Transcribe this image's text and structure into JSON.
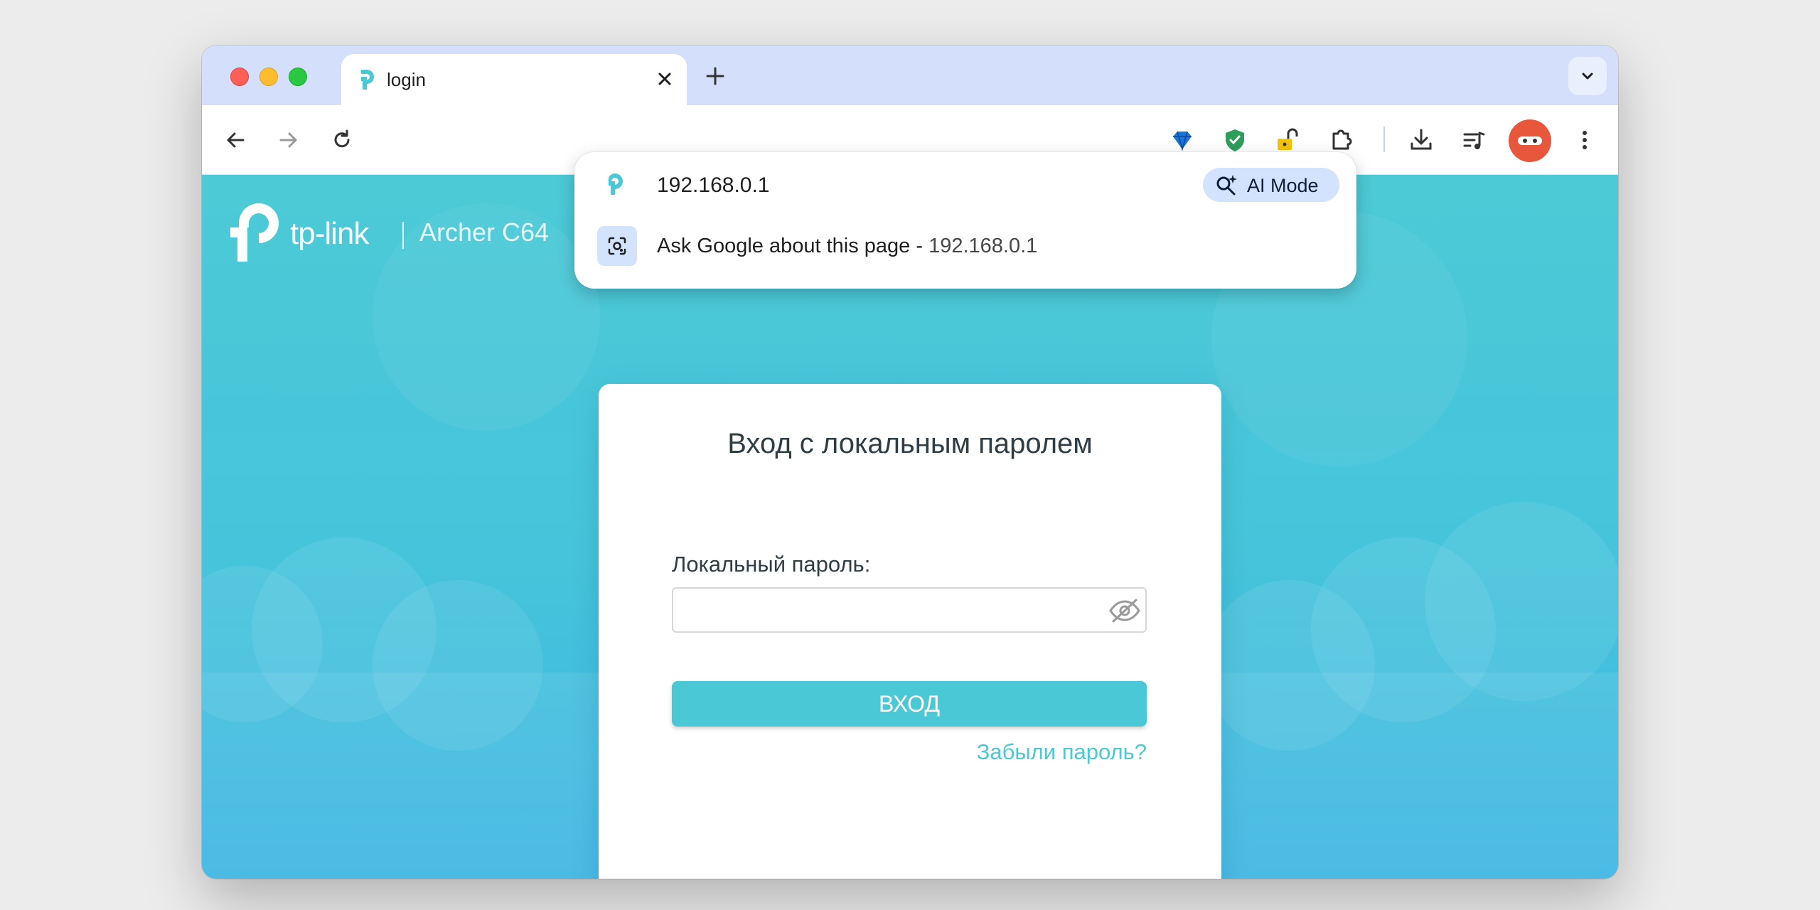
{
  "browser": {
    "tab": {
      "title": "login"
    },
    "omnibox": {
      "url": "192.168.0.1",
      "ai_mode_label": "AI Mode",
      "suggestion_prefix": "Ask Google about this page -",
      "suggestion_url": "192.168.0.1"
    },
    "icons": {
      "back": "back-arrow-icon",
      "forward": "forward-arrow-icon",
      "reload": "reload-icon",
      "extensions": [
        "diamond-extension-icon",
        "shield-extension-icon",
        "lock-extension-icon",
        "puzzle-icon"
      ],
      "download": "download-icon",
      "reading_list": "reading-list-icon",
      "menu": "kebab-menu-icon"
    },
    "accent_color": "#d4e0fb"
  },
  "page": {
    "brand_text": "tp-link",
    "model_text": "Archer C64",
    "card_title": "Вход с локальным паролем",
    "password_label": "Локальный пароль:",
    "password_value": "",
    "login_button": "ВХОД",
    "forgot_link": "Забыли пароль?",
    "accent_color": "#4bc8d6"
  }
}
